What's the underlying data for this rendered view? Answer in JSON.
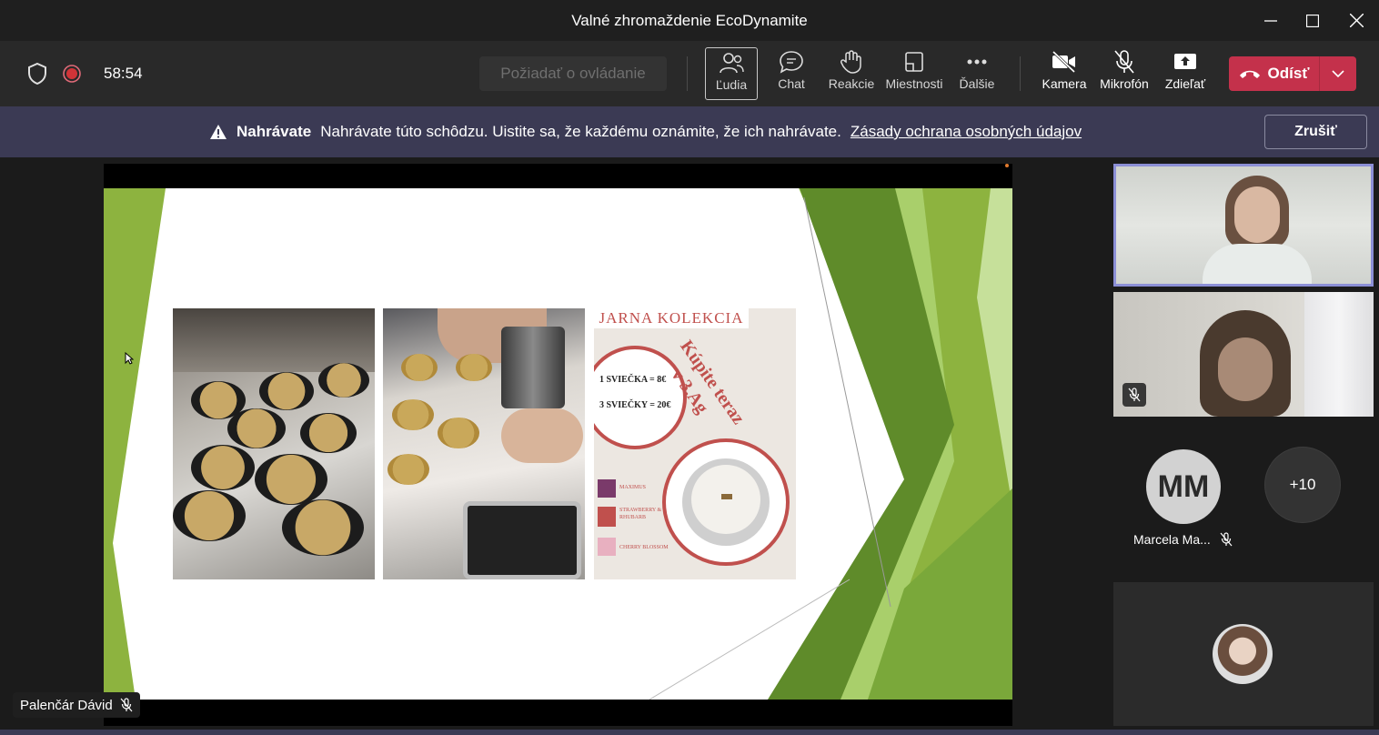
{
  "window": {
    "title": "Valné zhromaždenie EcoDynamite"
  },
  "toolbar": {
    "timer": "58:54",
    "request_control": "Požiadať o ovládanie",
    "buttons": {
      "people": "Ľudia",
      "chat": "Chat",
      "reactions": "Reakcie",
      "rooms": "Miestnosti",
      "more": "Ďalšie",
      "camera": "Kamera",
      "mic": "Mikrofón",
      "share": "Zdieľať"
    },
    "leave": "Odísť"
  },
  "banner": {
    "label": "Nahrávate",
    "message": "Nahrávate túto schôdzu. Uistite sa, že každému oznámite, že ich nahrávate.",
    "link": "Zásady ochrana osobných údajov",
    "cancel": "Zrušiť"
  },
  "slide": {
    "poster": {
      "title": "JARNA KOLEKCIA",
      "price1": "1 SVIEČKA = 8€",
      "price2": "3 SVIEČKY = 20€",
      "cta_line1": "Kúpite teraz",
      "cta_line2": "v 3.Ag",
      "scents": [
        "MAXIMUS",
        "STRAWBERRY & RHUBARB",
        "CHERRY BLOSSOM"
      ]
    }
  },
  "presenter": {
    "name": "Palenčár Dávid"
  },
  "participants": {
    "initials": "MM",
    "name": "Marcela Ma...",
    "overflow": "+10"
  },
  "colors": {
    "accent": "#c4314b",
    "banner": "#3b3a54",
    "slide_green": "#8db33f",
    "active_border": "#8c8fd6"
  }
}
